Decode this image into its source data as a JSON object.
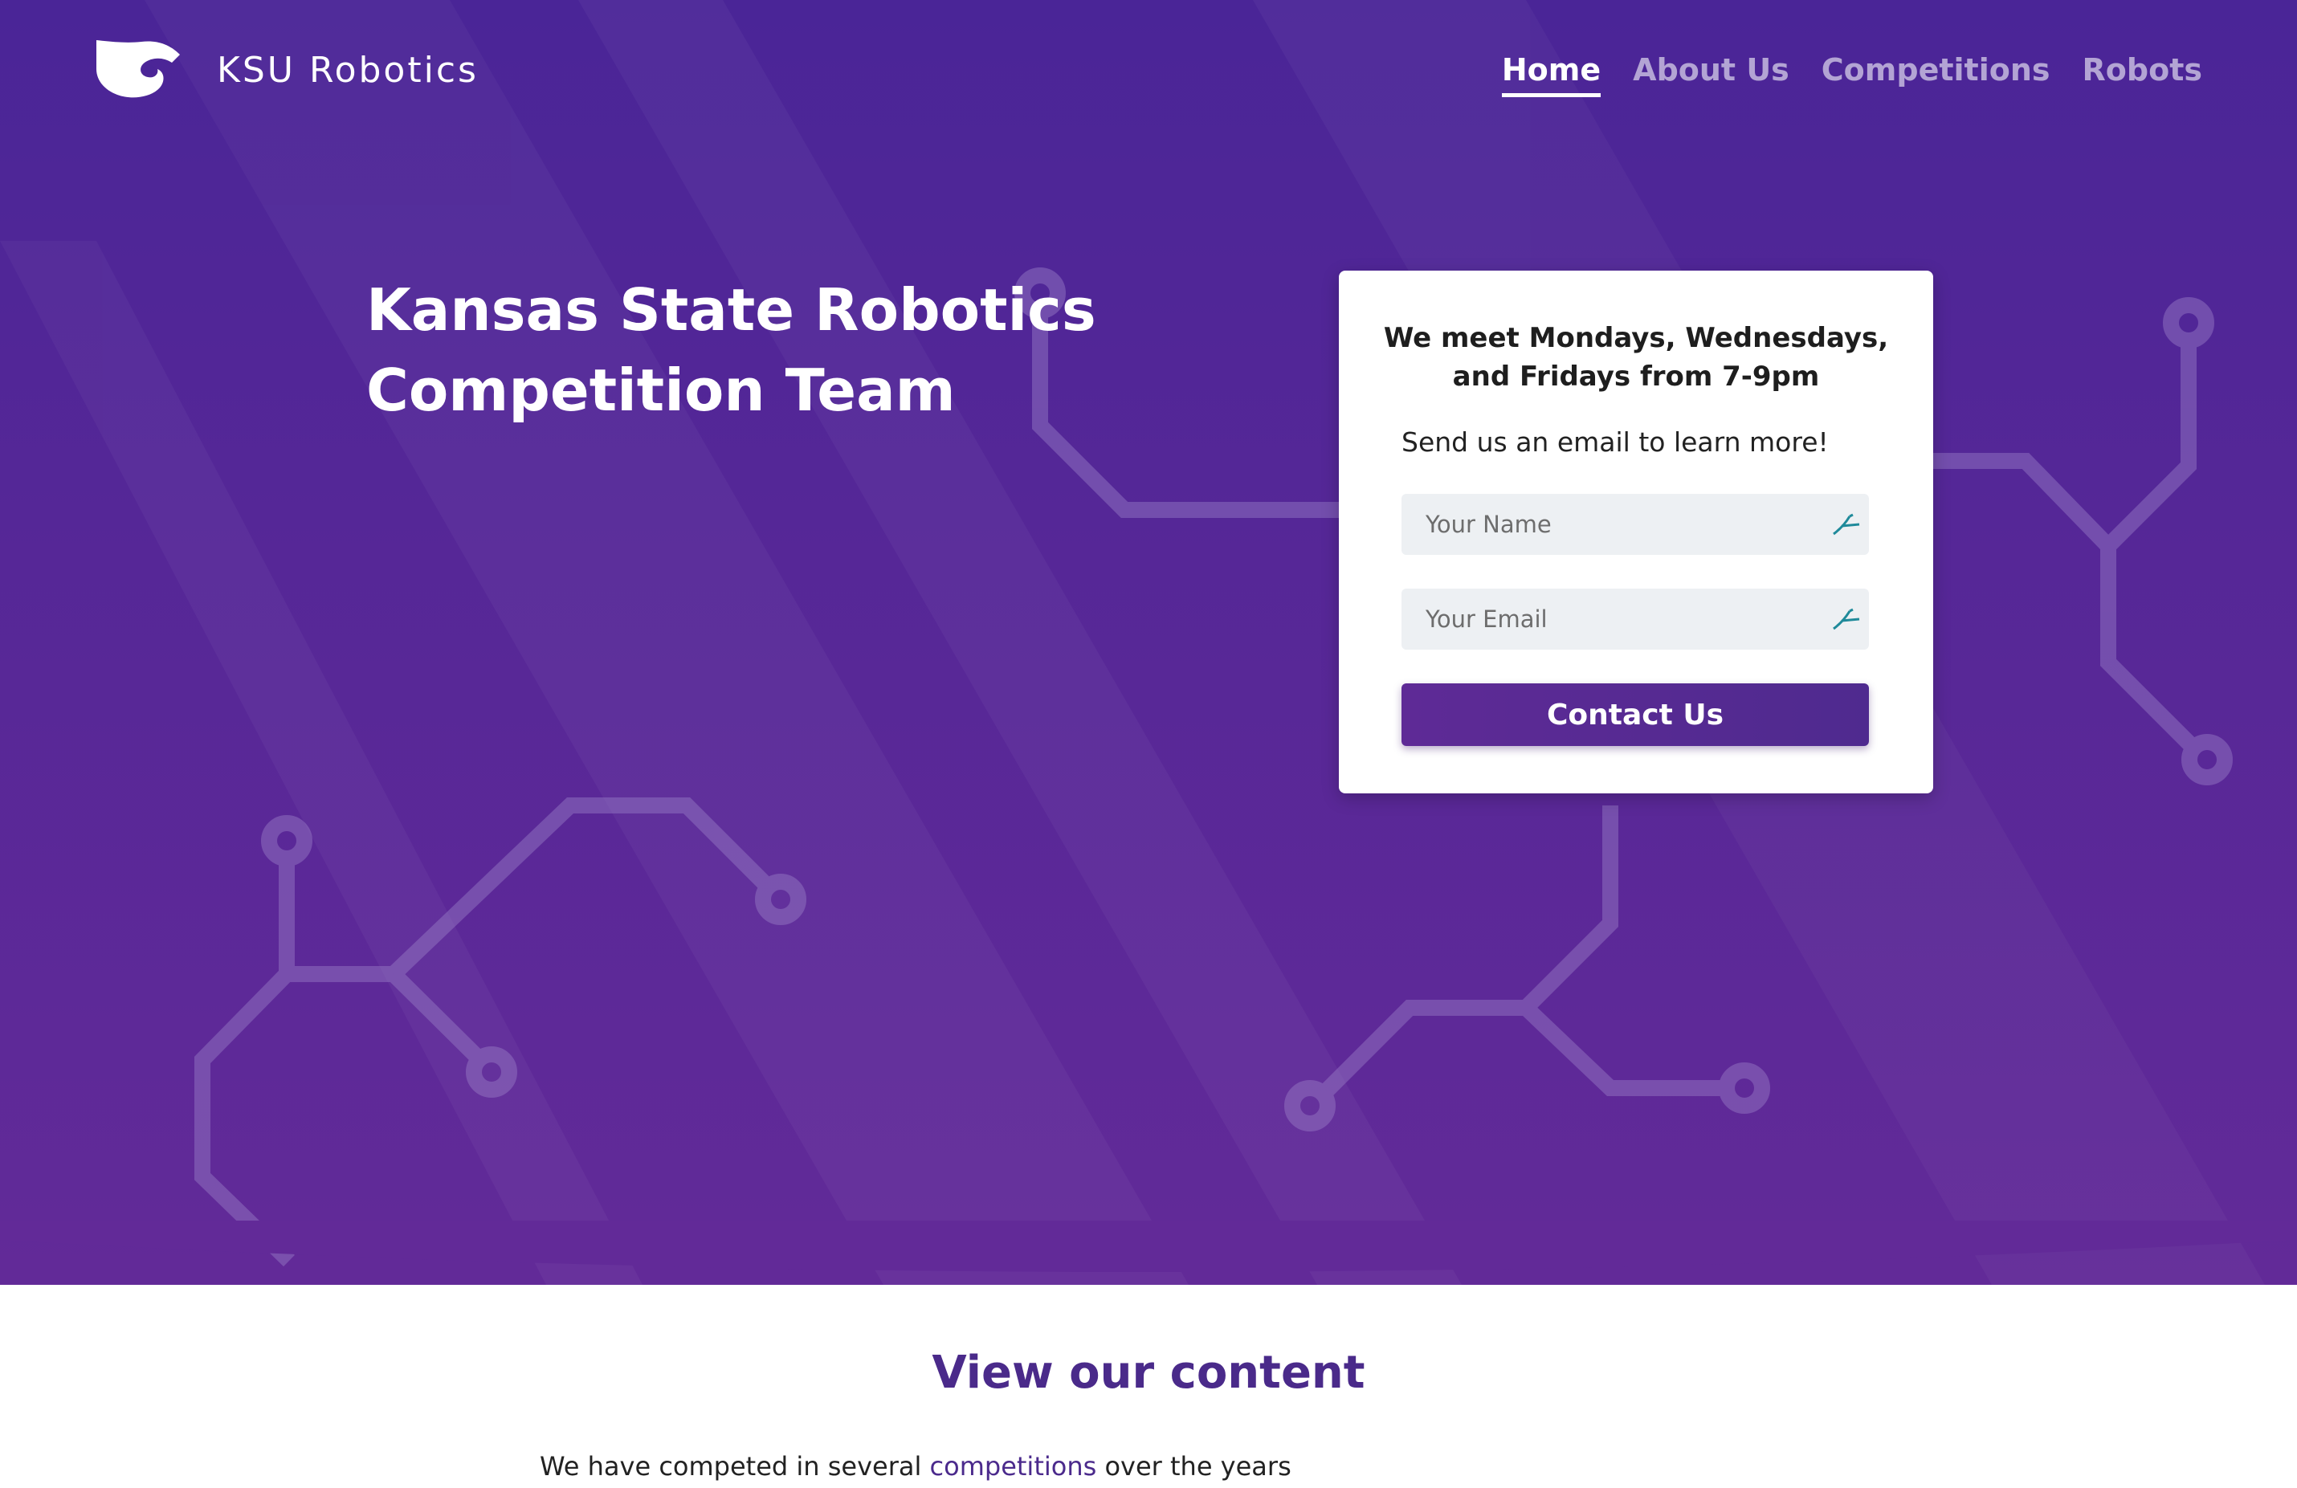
{
  "header": {
    "brand": "KSU Robotics",
    "logo_icon": "wildcat-logo-icon",
    "nav": [
      {
        "label": "Home",
        "active": true
      },
      {
        "label": "About Us",
        "active": false
      },
      {
        "label": "Competitions",
        "active": false
      },
      {
        "label": "Robots",
        "active": false
      }
    ]
  },
  "hero": {
    "title_line1": "Kansas State Robotics",
    "title_line2": "Competition Team"
  },
  "contact_card": {
    "heading_line1": "We meet Mondays, Wednesdays,",
    "heading_line2": "and Fridays from 7-9pm",
    "text": "Send us an email to learn more!",
    "name_placeholder": "Your Name",
    "email_placeholder": "Your Email",
    "field_icon": "autofill-icon",
    "button_label": "Contact Us"
  },
  "content": {
    "title": "View our content",
    "text_before": "We have competed in several ",
    "link": "competitions",
    "text_after": " over the years"
  },
  "colors": {
    "hero_purple": "#512696",
    "accent_purple": "#4a2a8a",
    "nav_inactive": "#b3a4d4"
  }
}
